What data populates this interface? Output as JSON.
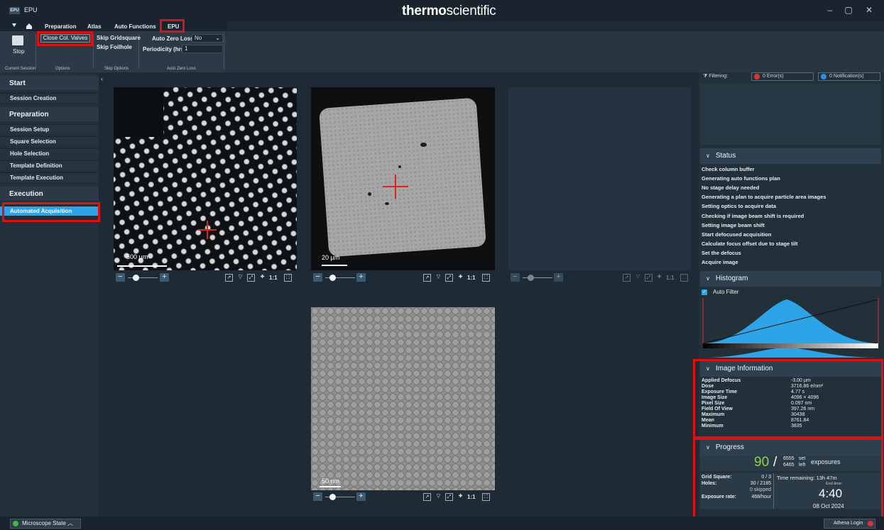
{
  "window": {
    "app_badge": "EPU",
    "app_name": "EPU",
    "brand_bold": "thermo",
    "brand_light": "scientific",
    "minimize": "–",
    "maximize": "▢",
    "close": "✕"
  },
  "menu": {
    "items": [
      "Preparation",
      "Atlas",
      "Auto Functions",
      "EPU"
    ],
    "active": "EPU"
  },
  "ribbon": {
    "stop_label": "Stop",
    "close_col_valves": "Close Col. Valves",
    "skip_gridsquare": "Skip Gridsquare",
    "skip_foilhole": "Skip Foilhole",
    "auto_zero_loss_label": "Auto Zero Loss",
    "auto_zero_loss_value": "No",
    "periodicity_label": "Periodicity (hrs)",
    "periodicity_value": "1",
    "groups": [
      "Current Session",
      "Options",
      "Skip Options",
      "Auto Zero Loss"
    ]
  },
  "nav": {
    "start_heading": "Start",
    "session_creation": "Session Creation",
    "preparation_heading": "Preparation",
    "session_setup": "Session Setup",
    "square_selection": "Square Selection",
    "hole_selection": "Hole Selection",
    "template_definition": "Template Definition",
    "template_execution": "Template Execution",
    "execution_heading": "Execution",
    "automated_acquisition": "Automated Acquisition"
  },
  "images": {
    "atlas_scale": "500 µm",
    "square_scale": "20 µm",
    "exposure_scale": "50 nm"
  },
  "toolbar": {
    "minus": "−",
    "plus": "+",
    "one_to_one": "1:1"
  },
  "filter": {
    "label": "Filtering:",
    "errors": "0 Error(s)",
    "notifications": "0 Notification(s)"
  },
  "status": {
    "heading": "Status",
    "lines": [
      "Check column buffer",
      "Generating auto functions plan",
      "No stage delay needed",
      "Generating a plan to acquire particle area images",
      "Setting optics to acquire data",
      "Checking if image beam shift is required",
      "Setting image beam shift",
      "Start defocused acquisition",
      "Calculate focus offset due to stage tilt",
      "Set the defocus",
      "Acquire image"
    ]
  },
  "histogram": {
    "heading": "Histogram",
    "auto_filter": "Auto Filter"
  },
  "image_information": {
    "heading": "Image Information",
    "rows": [
      {
        "key": "Applied Defocus",
        "value": "-3.00 µm"
      },
      {
        "key": "Dose",
        "value": "3716.86 e/nm²"
      },
      {
        "key": "Exposure Time",
        "value": "4.77 s"
      },
      {
        "key": "Image Size",
        "value": "4096 × 4096"
      },
      {
        "key": "Pixel Size",
        "value": "0.097 nm"
      },
      {
        "key": "Field Of View",
        "value": "397.26 nm"
      },
      {
        "key": "Maximum",
        "value": "30438"
      },
      {
        "key": "Mean",
        "value": "8761.84"
      },
      {
        "key": "Minimum",
        "value": "3835"
      }
    ]
  },
  "progress": {
    "heading": "Progress",
    "done": "90",
    "slash": "/",
    "set": "6555",
    "set_label": "set",
    "left": "6465",
    "left_label": "left",
    "exposures_label": "exposures",
    "grid_square_label": "Grid Square:",
    "grid_square_value": "0 / 3",
    "holes_label": "Holes:",
    "holes_value": "30 / 2185",
    "skipped_value": "0 skipped",
    "exposure_rate_label": "Exposure rate:",
    "exposure_rate_value": "468/hour",
    "time_remaining": "Time remaining: 13h 47m",
    "end_time_label": "End time:",
    "end_time": "4:40",
    "end_date": "08 Oct 2024"
  },
  "bottom": {
    "microscope_state": "Microscope State",
    "caret": "︿",
    "athena_login": "Athena Login"
  },
  "colors": {
    "accent": "#2da3e8",
    "highlight_red": "#e01010",
    "progress_green": "#8fd14f"
  }
}
